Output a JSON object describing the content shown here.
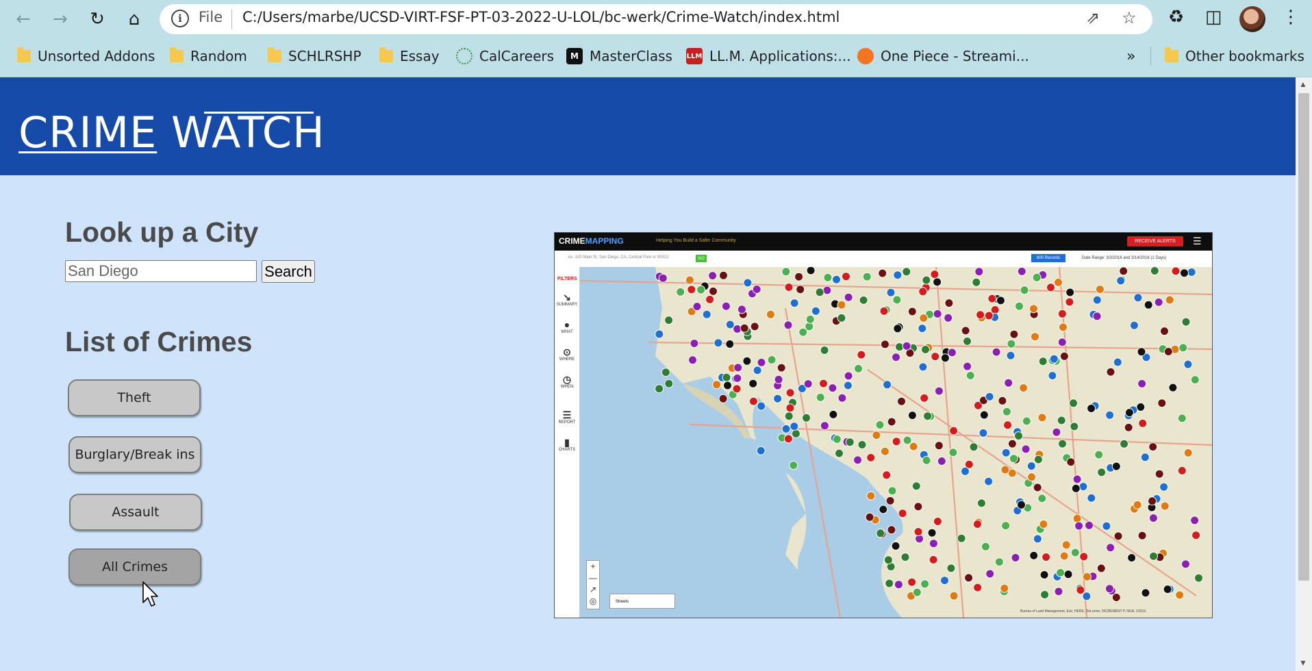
{
  "browser": {
    "file_label": "File",
    "url": "C:/Users/marbe/UCSD-VIRT-FSF-PT-03-2022-U-LOL/bc-werk/Crime-Watch/index.html",
    "bookmarks": [
      {
        "label": "Unsorted Addons",
        "icon": "folder-icon"
      },
      {
        "label": "Random",
        "icon": "folder-icon"
      },
      {
        "label": "SCHLRSHP",
        "icon": "folder-icon"
      },
      {
        "label": "Essay",
        "icon": "folder-icon"
      },
      {
        "label": "CalCareers",
        "icon": "calcareers-icon"
      },
      {
        "label": "MasterClass",
        "icon": "masterclass-icon"
      },
      {
        "label": "LL.M. Applications:...",
        "icon": "llm-icon"
      },
      {
        "label": "One Piece - Streami...",
        "icon": "crunchyroll-icon"
      }
    ],
    "overflow_label": "»",
    "other_bookmarks": "Other bookmarks"
  },
  "page": {
    "title_part1": "CRIME",
    "title_part2": " WATCH",
    "lookup_heading": "Look up a City",
    "city_input_value": "",
    "city_input_placeholder": "San Diego",
    "search_button": "Search",
    "crimes_heading": "List of Crimes",
    "crime_buttons": [
      "Theft",
      "Burglary/Break ins",
      "Assault",
      "All Crimes"
    ]
  },
  "map_image": {
    "logo_part1": "CRIME",
    "logo_part2": "MAPPING",
    "tagline": "Helping You Build a Safer Community",
    "alerts_button": "RECEIVE ALERTS",
    "search_placeholder": "ex. 100 Main St, San Diego, CA, Central Park or 90012",
    "go_button": "GO",
    "records_button": "800 Records",
    "date_range": "Date Range: 3/3/2016 and 3/14/2016 (1 Days)",
    "filters_label": "FILTERS",
    "sidebar": [
      "SUMMARY",
      "WHAT",
      "WHERE",
      "WHEN",
      "REPORT",
      "CHARTS"
    ],
    "basemap_select": "Streets",
    "credit": "Bureau of Land Management, Esri, HERE, DeLorme, INCREMENT P, NGA, USGS"
  },
  "colors": {
    "header_bg": "#164aa8",
    "page_bg": "#cfe4fa",
    "chrome_bg": "#bfe0e6",
    "button_bg": "#c8c8c8",
    "button_active_bg": "#a4a4a4"
  }
}
